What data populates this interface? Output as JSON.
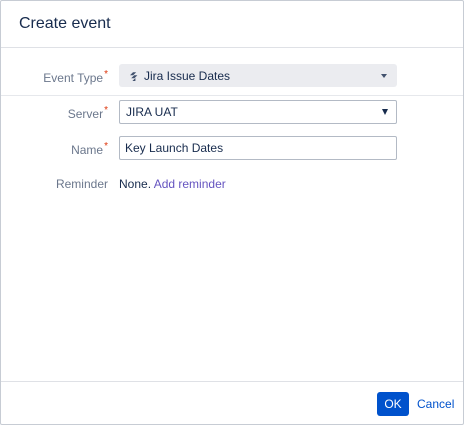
{
  "dialog": {
    "title": "Create event"
  },
  "form": {
    "event_type": {
      "label": "Event Type",
      "value": "Jira Issue Dates",
      "icon": "jira-icon",
      "required_mark": "*"
    },
    "server": {
      "label": "Server",
      "value": "JIRA UAT",
      "required_mark": "*"
    },
    "name": {
      "label": "Name",
      "value": "Key Launch Dates",
      "required_mark": "*"
    },
    "reminder": {
      "label": "Reminder",
      "value": "None.",
      "link": "Add reminder"
    }
  },
  "footer": {
    "ok_label": "OK",
    "cancel_label": "Cancel"
  },
  "colors": {
    "primary": "#0052cc",
    "link_purple": "#6554c0",
    "required": "#de350b"
  }
}
